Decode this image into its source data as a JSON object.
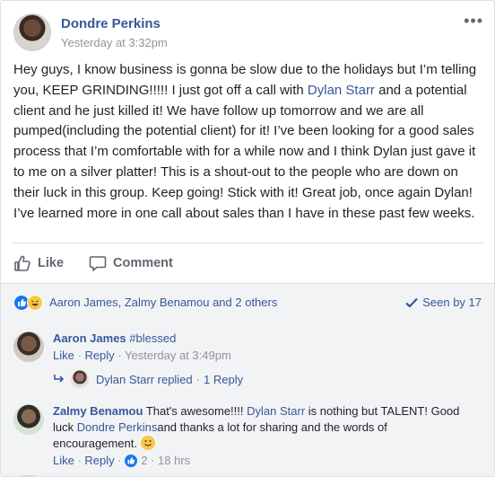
{
  "post": {
    "author": "Dondre Perkins",
    "timestamp": "Yesterday at 3:32pm",
    "more_label": "•••",
    "body_parts": {
      "p1": "Hey guys, I know business is gonna be slow due to the holidays but I’m telling you, KEEP GRINDING!!!!! I just got off a call with ",
      "mention1": "Dylan Starr",
      "p2": " and a potential client and he just killed it! We have follow up tomorrow and we are all pumped(including the potential client) for it! I’ve been looking for a good sales process that I’m comfortable with for a while now and I think Dylan just gave it to me on a silver platter! This is a shout-out to the people who are down on their luck in this group. Keep going! Stick with it! Great job, once again Dylan! I’ve learned more in one call about sales than I have in these past few weeks."
    }
  },
  "actions": {
    "like_label": "Like",
    "comment_label": "Comment"
  },
  "reactions": {
    "summary": "Aaron James, Zalmy Benamou and 2 others",
    "seen": "Seen by 17"
  },
  "comments": [
    {
      "author": "Aaron James",
      "text": "#blessed",
      "like_label": "Like",
      "reply_label": "Reply",
      "time": "Yesterday at 3:49pm",
      "replies_summary": "Dylan Starr replied",
      "replies_count": "1 Reply"
    },
    {
      "author": "Zalmy Benamou",
      "text_a": "That's awesome!!!! ",
      "mention1": "Dylan Starr",
      "text_b": " is nothing but TALENT! Good luck ",
      "mention2": "Dondre Perkins",
      "text_c": "and thanks a lot for sharing and the words of encouragement.",
      "like_label": "Like",
      "reply_label": "Reply",
      "like_count": "2",
      "time": "18 hrs"
    }
  ],
  "colors": {
    "link": "#365899",
    "meta": "#90949c",
    "background_comments": "#f2f3f5",
    "like_blue": "#1877f2"
  },
  "icons": {
    "more": "more-options-icon",
    "like": "thumbs-up-icon",
    "comment": "speech-bubble-icon",
    "seen": "checkmark-icon",
    "reply_arrow": "reply-arrow-icon",
    "emoji": "smiley-emoji-icon"
  }
}
